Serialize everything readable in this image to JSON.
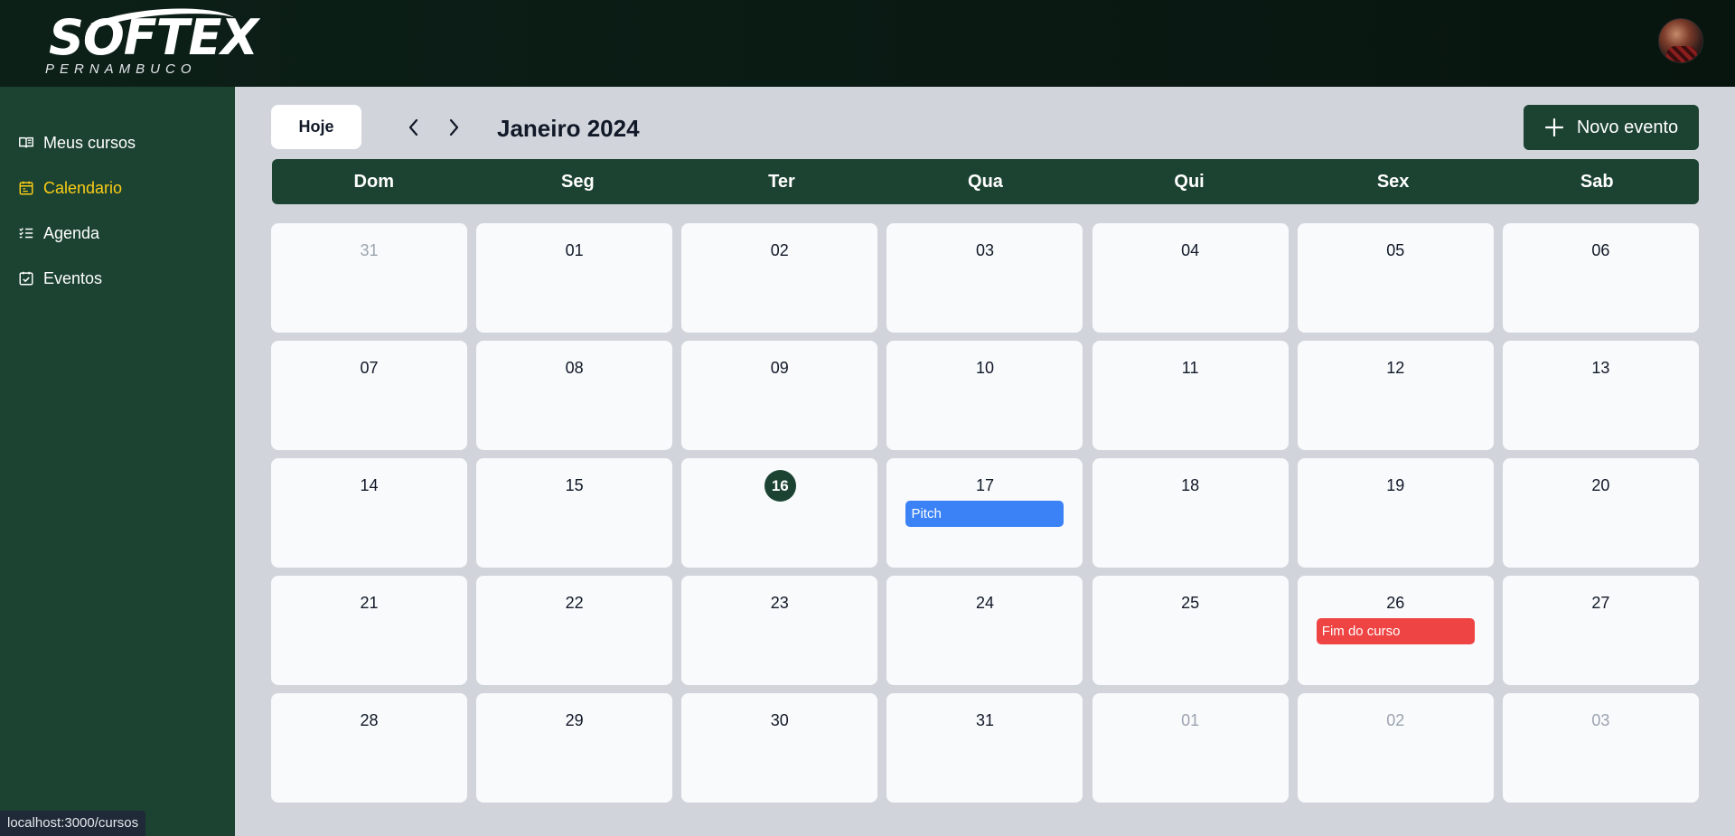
{
  "header": {
    "logo_text": "SOFTEX",
    "logo_subtext": "PERNAMBUCO"
  },
  "sidebar": {
    "items": [
      {
        "label": "Meus cursos",
        "icon": "book-open-icon",
        "active": false
      },
      {
        "label": "Calendario",
        "icon": "calendar-icon",
        "active": true
      },
      {
        "label": "Agenda",
        "icon": "list-checks-icon",
        "active": false
      },
      {
        "label": "Eventos",
        "icon": "calendar-check-icon",
        "active": false
      }
    ]
  },
  "toolbar": {
    "today_label": "Hoje",
    "month_title": "Janeiro 2024",
    "new_event_label": "Novo evento"
  },
  "weekdays": [
    "Dom",
    "Seg",
    "Ter",
    "Qua",
    "Qui",
    "Sex",
    "Sab"
  ],
  "days": [
    {
      "num": "31",
      "muted": true
    },
    {
      "num": "01"
    },
    {
      "num": "02"
    },
    {
      "num": "03"
    },
    {
      "num": "04"
    },
    {
      "num": "05"
    },
    {
      "num": "06"
    },
    {
      "num": "07"
    },
    {
      "num": "08"
    },
    {
      "num": "09"
    },
    {
      "num": "10"
    },
    {
      "num": "11"
    },
    {
      "num": "12"
    },
    {
      "num": "13"
    },
    {
      "num": "14"
    },
    {
      "num": "15"
    },
    {
      "num": "16",
      "today": true
    },
    {
      "num": "17",
      "event": {
        "label": "Pitch",
        "color": "#3b82f6"
      }
    },
    {
      "num": "18"
    },
    {
      "num": "19"
    },
    {
      "num": "20"
    },
    {
      "num": "21"
    },
    {
      "num": "22"
    },
    {
      "num": "23"
    },
    {
      "num": "24"
    },
    {
      "num": "25"
    },
    {
      "num": "26",
      "event": {
        "label": "Fim do curso",
        "color": "#ef4444"
      }
    },
    {
      "num": "27"
    },
    {
      "num": "28"
    },
    {
      "num": "29"
    },
    {
      "num": "30"
    },
    {
      "num": "31"
    },
    {
      "num": "01",
      "muted": true
    },
    {
      "num": "02",
      "muted": true
    },
    {
      "num": "03",
      "muted": true
    }
  ],
  "colors": {
    "sidebar_bg": "#1c4332",
    "active_nav": "#facc15",
    "today_circle": "#1c4332"
  },
  "statusbar": {
    "url": "localhost:3000/cursos"
  }
}
